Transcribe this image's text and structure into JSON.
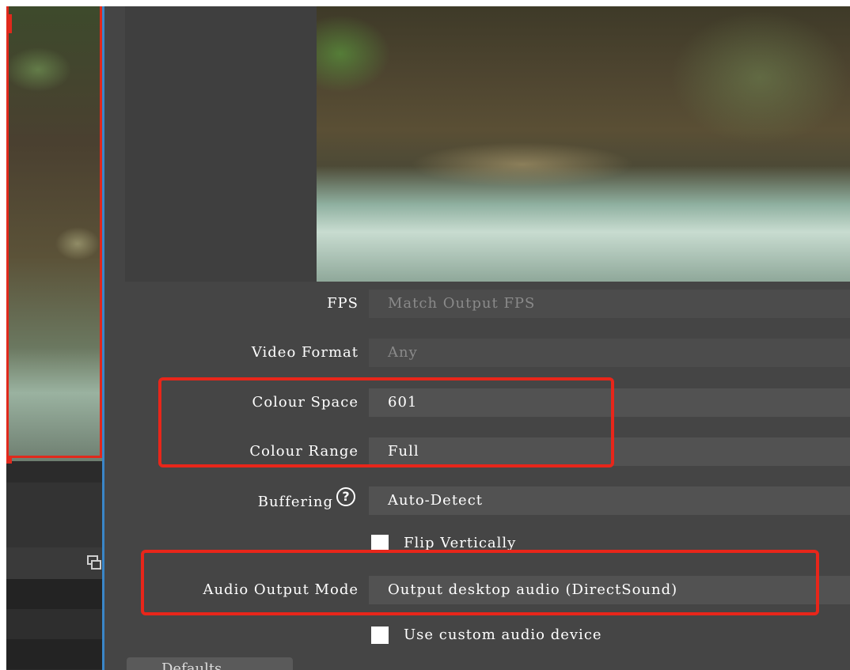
{
  "properties": {
    "fps": {
      "label": "FPS",
      "value": "Match Output FPS"
    },
    "video_format": {
      "label": "Video Format",
      "value": "Any"
    },
    "colour_space": {
      "label": "Colour Space",
      "value": "601"
    },
    "colour_range": {
      "label": "Colour Range",
      "value": "Full"
    },
    "buffering": {
      "label": "Buffering",
      "value": "Auto-Detect",
      "help_icon": "?"
    },
    "flip_vertically": {
      "label": "Flip Vertically",
      "checked": false
    },
    "audio_output_mode": {
      "label": "Audio Output Mode",
      "value": "Output desktop audio (DirectSound)"
    },
    "use_custom_audio_device": {
      "label": "Use custom audio device",
      "checked": false
    }
  },
  "buttons": {
    "defaults_label": "Defaults"
  },
  "icons": {
    "dock_float": "float-window-icon",
    "help": "question-circle-icon"
  },
  "colors": {
    "annotation": "#e8261a",
    "selection": "#e0291c",
    "divider": "#3a86c8",
    "dialog_bg": "#454545",
    "field_bg": "#525252"
  }
}
